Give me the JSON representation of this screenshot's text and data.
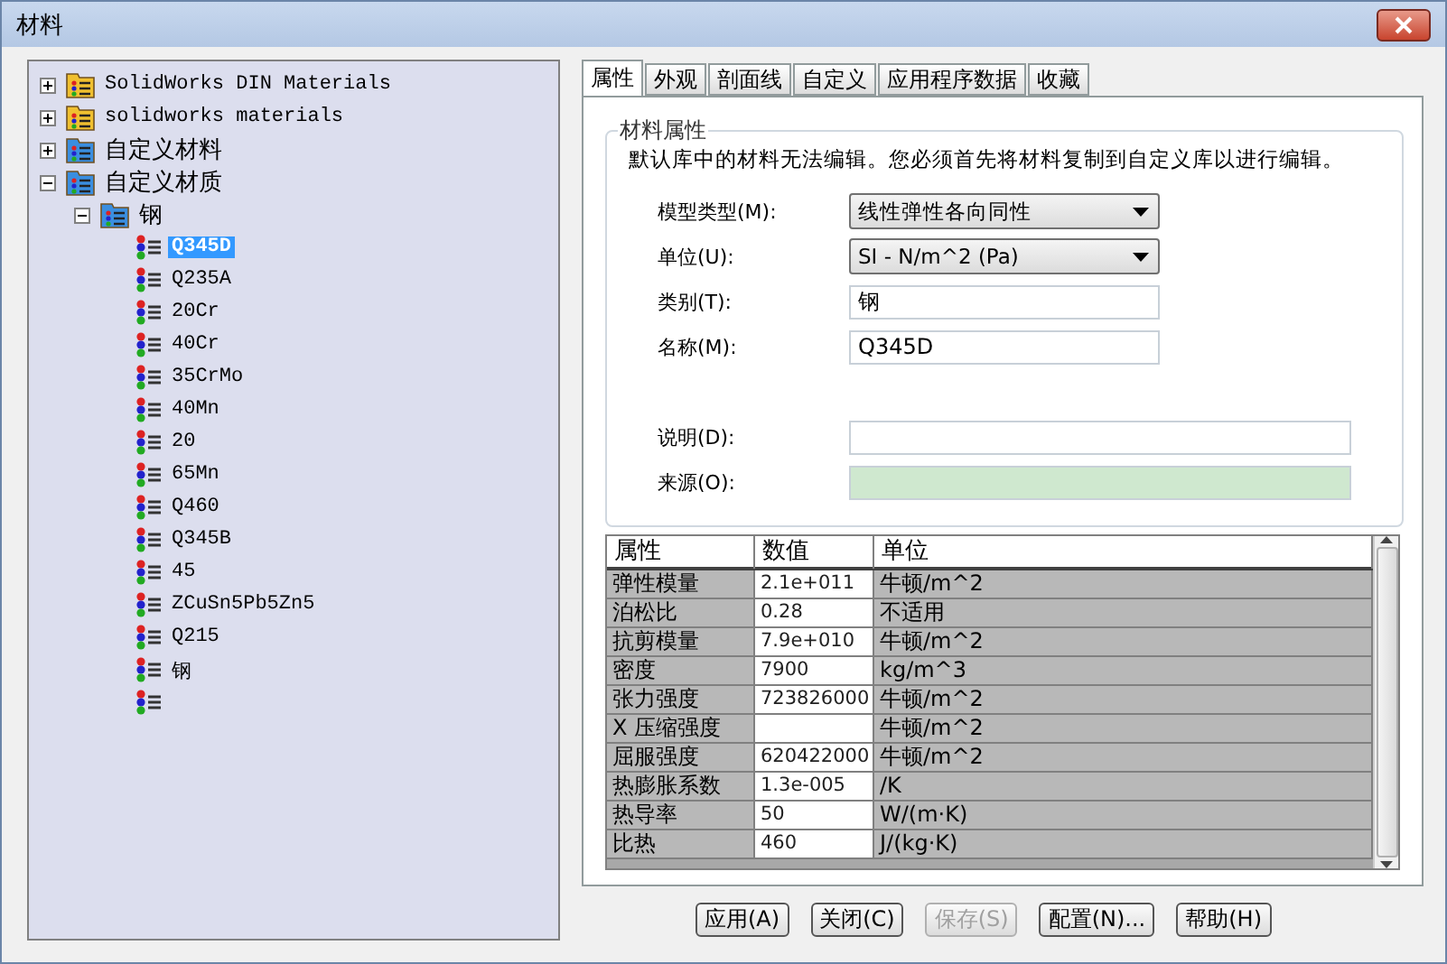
{
  "window": {
    "title": "材料"
  },
  "tree": [
    {
      "label": "SolidWorks DIN Materials",
      "kind": "library",
      "expanded": false,
      "selected": false
    },
    {
      "label": "solidworks materials",
      "kind": "library",
      "expanded": false,
      "selected": false
    },
    {
      "label": "自定义材料",
      "kind": "folder",
      "expanded": false,
      "selected": false
    },
    {
      "label": "自定义材质",
      "kind": "folder",
      "expanded": true,
      "selected": false,
      "children": [
        {
          "label": "钢",
          "kind": "folder",
          "expanded": true,
          "selected": false,
          "children": [
            {
              "label": "Q345D",
              "kind": "material",
              "selected": true
            },
            {
              "label": "Q235A",
              "kind": "material",
              "selected": false
            },
            {
              "label": "20Cr",
              "kind": "material",
              "selected": false
            },
            {
              "label": "40Cr",
              "kind": "material",
              "selected": false
            },
            {
              "label": "35CrMo",
              "kind": "material",
              "selected": false
            },
            {
              "label": "40Mn",
              "kind": "material",
              "selected": false
            },
            {
              "label": "20",
              "kind": "material",
              "selected": false
            },
            {
              "label": "65Mn",
              "kind": "material",
              "selected": false
            },
            {
              "label": "Q460",
              "kind": "material",
              "selected": false
            },
            {
              "label": "Q345B",
              "kind": "material",
              "selected": false
            },
            {
              "label": "45",
              "kind": "material",
              "selected": false
            },
            {
              "label": "ZCuSn5Pb5Zn5",
              "kind": "material",
              "selected": false
            },
            {
              "label": "Q215",
              "kind": "material",
              "selected": false
            },
            {
              "label": "钢",
              "kind": "material",
              "selected": false
            },
            {
              "kind": "material",
              "selected": false
            }
          ]
        }
      ]
    }
  ],
  "tabs": [
    {
      "label": "属性",
      "selected": true
    },
    {
      "label": "外观",
      "selected": false
    },
    {
      "label": "剖面线",
      "selected": false
    },
    {
      "label": "自定义",
      "selected": false
    },
    {
      "label": "应用程序数据",
      "selected": false
    },
    {
      "label": "收藏",
      "selected": false
    }
  ],
  "group": {
    "title": "材料属性",
    "note": "默认库中的材料无法编辑。您必须首先将材料复制到自定义库以进行编辑。"
  },
  "fields": [
    {
      "label": "模型类型(M):",
      "kind": "dropdown",
      "value": "线性弹性各向同性"
    },
    {
      "label": "单位(U):",
      "kind": "dropdown",
      "value": "SI - N/m^2 (Pa)"
    },
    {
      "label": "类别(T):",
      "kind": "text",
      "value": "钢"
    },
    {
      "label": "名称(M):",
      "kind": "text",
      "value": "Q345D"
    },
    {
      "label": "说明(D):",
      "kind": "wide",
      "readonly": false
    },
    {
      "label": "来源(O):",
      "kind": "wide",
      "readonly": true
    }
  ],
  "table": {
    "columns": [
      "属性",
      "数值",
      "单位"
    ],
    "rows": [
      [
        "弹性模量",
        "2.1e+011",
        "牛顿/m^2"
      ],
      [
        "泊松比",
        "0.28",
        "不适用"
      ],
      [
        "抗剪模量",
        "7.9e+010",
        "牛顿/m^2"
      ],
      [
        "密度",
        "7900",
        "kg/m^3"
      ],
      [
        "张力强度",
        "723826000",
        "牛顿/m^2"
      ],
      [
        "X 压缩强度",
        null,
        "牛顿/m^2"
      ],
      [
        "屈服强度",
        "620422000",
        "牛顿/m^2"
      ],
      [
        "热膨胀系数",
        "1.3e-005",
        "/K"
      ],
      [
        "热导率",
        "50",
        "W/(m·K)"
      ],
      [
        "比热",
        "460",
        "J/(kg·K)"
      ]
    ]
  },
  "buttons": [
    {
      "label": "应用(A)",
      "disabled": false
    },
    {
      "label": "关闭(C)",
      "disabled": false
    },
    {
      "label": "保存(S)",
      "disabled": true
    },
    {
      "label": "配置(N)...",
      "disabled": false
    },
    {
      "label": "帮助(H)",
      "disabled": false
    }
  ]
}
